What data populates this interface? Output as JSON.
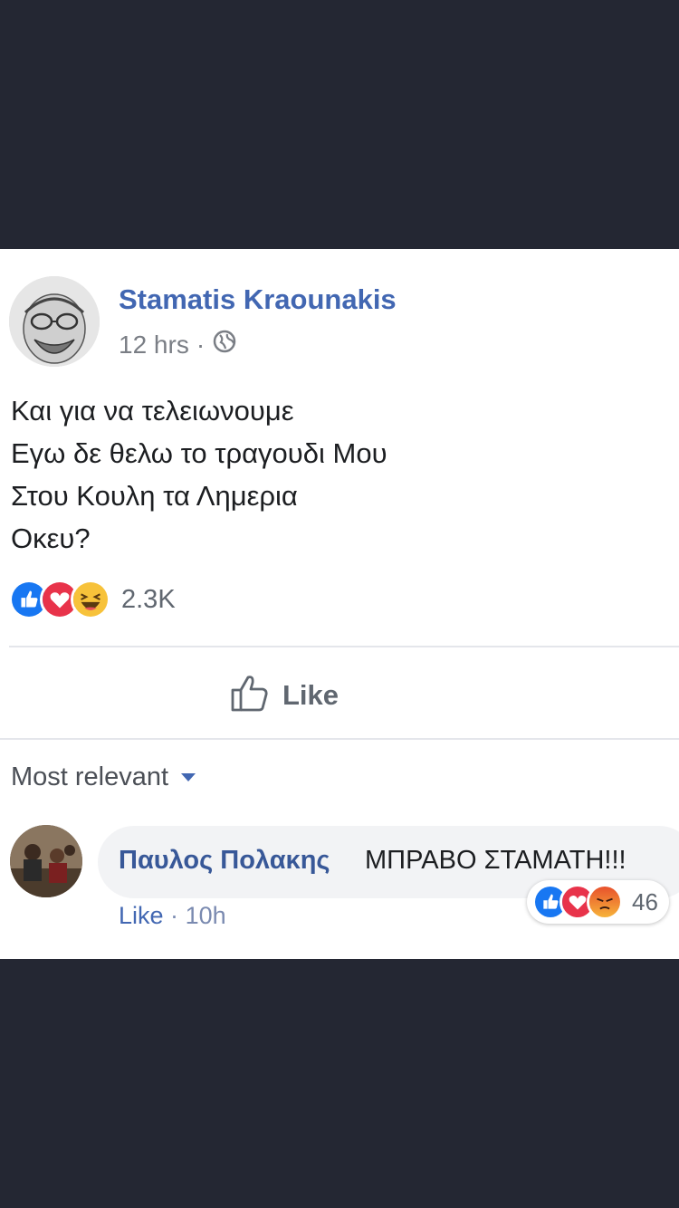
{
  "post": {
    "author": "Stamatis Kraounakis",
    "time": "12 hrs",
    "separator": "·",
    "privacy_icon": "globe-icon",
    "lines": [
      "Και για να τελειωνουμε",
      "Εγω δε θελω το τραγουδι Μου",
      "Στου Κουλη τα Λημερια",
      "Οκευ?"
    ],
    "reactions": [
      "like-icon",
      "love-icon",
      "haha-icon"
    ],
    "reaction_count": "2.3K",
    "like_label": "Like"
  },
  "comments": {
    "sort_label": "Most relevant",
    "items": [
      {
        "author": "Παυλος Πολακης",
        "text": "ΜΠΡΑΒΟ ΣΤΑΜΑΤΗ!!!",
        "like_label": "Like",
        "separator": "·",
        "time": "10h",
        "reactions": [
          "like-icon",
          "love-icon",
          "angry-icon"
        ],
        "reaction_count": "46"
      }
    ]
  },
  "colors": {
    "background": "#242733",
    "link_blue": "#4267b2",
    "like_blue": "#1877f2",
    "love_red": "#e8334a",
    "haha_yellow": "#f7c23a"
  }
}
